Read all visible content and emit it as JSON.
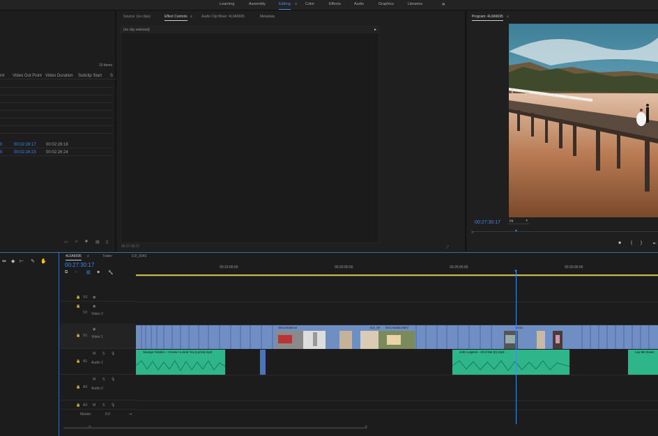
{
  "workspaces": {
    "items": [
      "Learning",
      "Assembly",
      "Editing",
      "Color",
      "Effects",
      "Audio",
      "Graphics",
      "Libraries"
    ],
    "active_index": 2,
    "menu_glyph": "≡",
    "more_glyph": "»"
  },
  "project": {
    "items_count": "10 items",
    "columns": [
      "int",
      "Video Out Point",
      "Video Duration",
      "Subclip Start",
      "S"
    ],
    "rows": [
      {
        "in": "0",
        "out": "00:02:26:17",
        "dur": "00:02:26:18"
      },
      {
        "in": "0",
        "out": "00:02:26:23",
        "dur": "00:02:26:24"
      }
    ]
  },
  "source": {
    "tabs": [
      "Source: (no clips)",
      "Effect Controls",
      "Audio Clip Mixer: 4L0A6695",
      "Metadata"
    ],
    "active_tab": 1,
    "menu_glyph": "≡",
    "no_clip": "(no clip selected)",
    "timecode": "00:27:30:17"
  },
  "program": {
    "title": "Program: 4L0A6695",
    "menu_glyph": "≡",
    "timecode": "00:27:30:17",
    "fit": "Fit"
  },
  "timeline": {
    "tabs": [
      "4L0A6695",
      "Trailer",
      "DJI_0043"
    ],
    "menu_glyph": "≡",
    "timecode": "00:27:30:17",
    "ruler": [
      "00:15:00:00",
      "00:20:00:00",
      "00:25:00:00",
      "00:30:00:00"
    ],
    "tracks": {
      "v3": "V3",
      "v2": "V2",
      "video2": "Video 2",
      "v1": "V1",
      "video1": "Video 1",
      "a1": "A1",
      "audio1": "Audio 1",
      "a2": "A2",
      "audio2": "Audio 2",
      "a3": "A3",
      "master": "Master",
      "master_val": "0.0"
    },
    "video_clips": [
      "SH1A0468.M",
      "DJI_00",
      "SH1A0455.MOV",
      "SH1A"
    ],
    "audio_clips": [
      "Savage Garden - I Knew I Loved You [Lyrics].mp3",
      "John Legend - All of Me (K).mp3",
      "Lay Me Down"
    ]
  },
  "colors": {
    "accent": "#3b8be8",
    "video_clip": "#6f8fc4",
    "audio_clip": "#2fb58a"
  }
}
